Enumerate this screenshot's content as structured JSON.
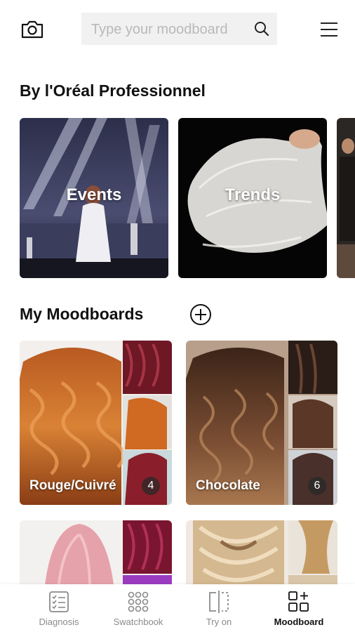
{
  "header": {
    "search_placeholder": "Type your moodboard"
  },
  "brand_section": {
    "title": "By l'Oréal Professionnel",
    "cards": [
      {
        "label": "Events"
      },
      {
        "label": "Trends"
      }
    ]
  },
  "moodboards": {
    "title": "My Moodboards",
    "items": [
      {
        "name": "Rouge/Cuivré",
        "count": "4"
      },
      {
        "name": "Chocolate",
        "count": "6"
      }
    ]
  },
  "bottom_nav": {
    "items": [
      {
        "label": "Diagnosis",
        "icon": "diagnosis-icon"
      },
      {
        "label": "Swatchbook",
        "icon": "swatchbook-icon"
      },
      {
        "label": "Try on",
        "icon": "try-on-icon"
      },
      {
        "label": "Moodboard",
        "icon": "moodboard-icon"
      }
    ],
    "active_index": 3
  },
  "colors": {
    "text": "#111111",
    "nav_inactive": "#8a8a8a",
    "search_bg": "#f1f1f1"
  }
}
